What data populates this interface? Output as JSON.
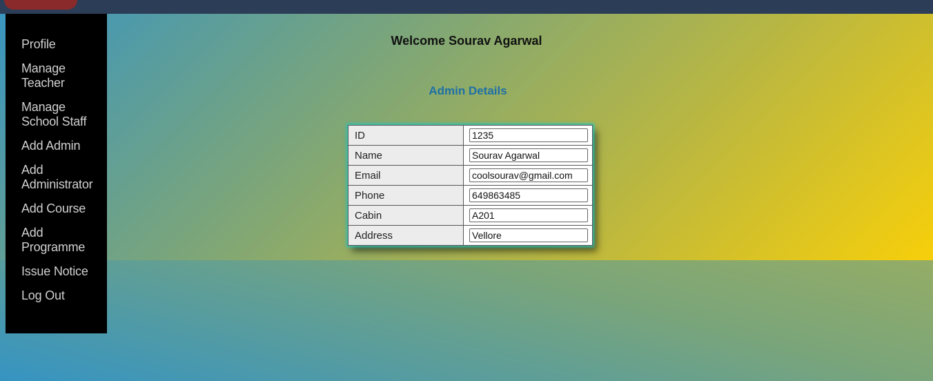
{
  "welcome_text": "Welcome Sourav Agarwal",
  "section_title": "Admin Details",
  "sidebar": {
    "items": [
      {
        "label": "Profile"
      },
      {
        "label": "Manage\nTeacher"
      },
      {
        "label": "Manage\nSchool Staff"
      },
      {
        "label": "Add Admin"
      },
      {
        "label": "Add\nAdministrator"
      },
      {
        "label": "Add Course"
      },
      {
        "label": "Add\nProgramme"
      },
      {
        "label": "Issue Notice"
      },
      {
        "label": "Log Out"
      }
    ]
  },
  "details": [
    {
      "label": "ID",
      "value": "1235"
    },
    {
      "label": "Name",
      "value": "Sourav Agarwal"
    },
    {
      "label": "Email",
      "value": "coolsourav@gmail.com"
    },
    {
      "label": "Phone",
      "value": "649863485"
    },
    {
      "label": "Cabin",
      "value": "A201"
    },
    {
      "label": "Address",
      "value": "Vellore"
    }
  ],
  "colors": {
    "topbar": "#2c3e57",
    "sidebar": "#000000",
    "title_accent": "#1e6fa6",
    "table_glow": "#2ec4b6"
  }
}
